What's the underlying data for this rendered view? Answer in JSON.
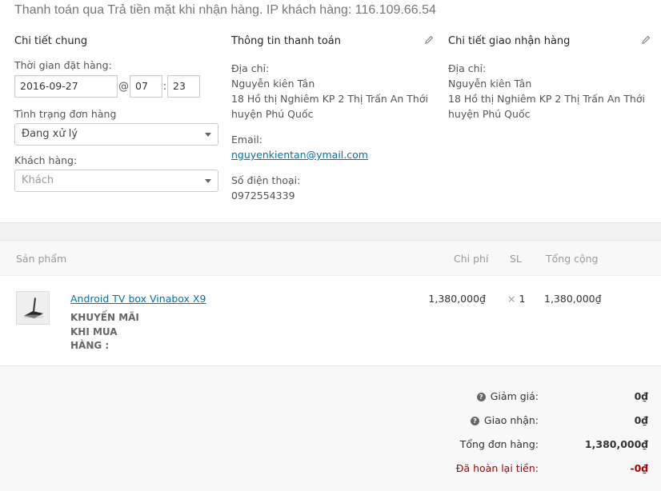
{
  "header": {
    "payment_note": "Thanh toán qua Trả tiền mặt khi nhận hàng. IP khách hàng: 116.109.66.54"
  },
  "general": {
    "title": "Chi tiết chung",
    "date_label": "Thời gian đặt hàng:",
    "date_value": "2016-09-27",
    "at_sign": "@",
    "hour_value": "07",
    "colon": ":",
    "minute_value": "23",
    "status_label": "Tình trạng đơn hàng",
    "status_value": "Đang xử lý",
    "customer_label": "Khách hàng:",
    "customer_placeholder": "Khách"
  },
  "billing": {
    "title": "Thông tin thanh toán",
    "address_label": "Địa chỉ:",
    "address_lines": [
      "Nguyễn kiên Tân",
      "18 Hồ thị Nghiêm KP 2 Thị Trấn An Thới",
      "huyện Phú Quốc"
    ],
    "email_label": "Email:",
    "email_value": "nguyenkientan@ymail.com",
    "phone_label": "Số điện thoại:",
    "phone_value": "0972554339",
    "edit_icon": "pencil-icon"
  },
  "shipping": {
    "title": "Chi tiết giao nhận hàng",
    "address_label": "Địa chỉ:",
    "address_lines": [
      "Nguyễn kiên Tân",
      "18 Hồ thị Nghiêm KP 2 Thị Trấn An Thới",
      "huyện Phú Quốc"
    ],
    "edit_icon": "pencil-icon"
  },
  "items": {
    "columns": {
      "product": "Sản phẩm",
      "cost": "Chi phí",
      "qty": "SL",
      "total": "Tổng cộng"
    },
    "rows": [
      {
        "name": "Android TV box Vinabox X9",
        "meta_lines": [
          "KHUYẾN MÃI",
          "KHI MUA",
          "HÀNG :"
        ],
        "cost": "1,380,000₫",
        "qty_prefix": "×",
        "qty": "1",
        "total": "1,380,000₫"
      }
    ]
  },
  "totals": {
    "discount_label": "Giảm giá:",
    "discount_value": "0₫",
    "shipping_label": "Giao nhận:",
    "shipping_value": "0₫",
    "order_total_label": "Tổng đơn hàng:",
    "order_total_value": "1,380,000₫",
    "refunded_label": "Đã hoàn lại tiền:",
    "refunded_value": "-0₫"
  },
  "colors": {
    "link": "#0073aa",
    "refund": "#aa0000",
    "muted": "#999999"
  }
}
